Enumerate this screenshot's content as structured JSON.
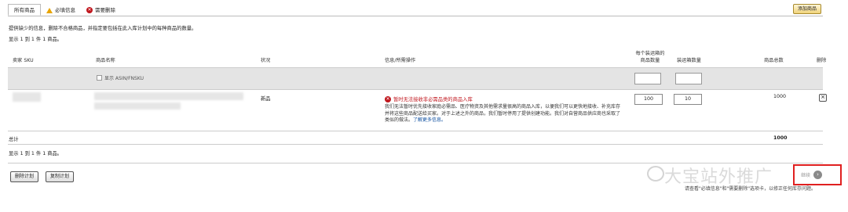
{
  "tabs": [
    {
      "label": "所有商品"
    },
    {
      "label": "必填信息"
    },
    {
      "label": "需要删除"
    }
  ],
  "add_button_label": "添加商品",
  "description": "提供缺少的信息，删除不合格商品，并指定要包括在此入库计划中的每种商品的数量。",
  "count_text": "显示 1 到 1 件 1 商品。",
  "headers": {
    "seller_sku": "卖家 SKU",
    "product_name": "商品名称",
    "condition": "状况",
    "info_action": "信息/所需操作",
    "units_per_case": "每个装运箱的\n商品数量",
    "num_cases": "装运箱数量",
    "total_units": "商品总数",
    "remove": "删除"
  },
  "filter_row": {
    "asin_toggle_label": "显示 ASIN/FNSKU"
  },
  "row": {
    "condition": "新品",
    "warning_title": "暂时无法接收非必需品类的商品入库",
    "warning_body": "我们无法暂时优先接收家庭必需品、医疗物资及其他需求量很高的商品入库，以便我们可以更快地接收、补充库存并将这些商品配送给买家。对于上述之外的商品，我们暂时停用了提供创建功能。我们对自营商品供应商也采取了类似的做法。",
    "warning_link": "了解更多信息。",
    "units_per_case": "100",
    "num_cases": "10",
    "total_units": "1000"
  },
  "total_label": "总计",
  "total_value": "1000",
  "count_text_bottom": "显示 1 到 1 件 1 商品。",
  "buttons": {
    "delete_plan": "删除计划",
    "copy_plan": "复制计划",
    "continue": "继续"
  },
  "watermark_text": "大宝站外推广",
  "bottom_note": "请查看\"必填信息\"和\"需要删除\"选项卡，以修正任何库存问题。"
}
